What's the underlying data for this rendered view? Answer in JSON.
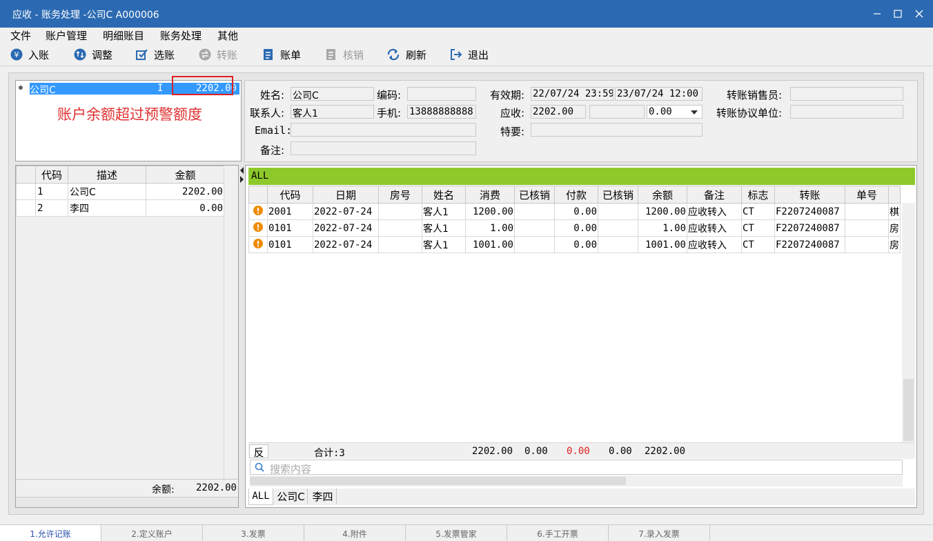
{
  "window": {
    "title": "应收 - 账务处理 -公司C  A000006"
  },
  "menu": [
    "文件",
    "账户管理",
    "明细账目",
    "账务处理",
    "其他"
  ],
  "toolbar": [
    {
      "label": "入账",
      "icon": "yen-icon",
      "enabled": true
    },
    {
      "label": "调整",
      "icon": "adjust-icon",
      "enabled": true
    },
    {
      "label": "选账",
      "icon": "select-check-icon",
      "enabled": true
    },
    {
      "label": "转账",
      "icon": "transfer-icon",
      "enabled": false
    },
    {
      "label": "账单",
      "icon": "bill-icon",
      "enabled": true
    },
    {
      "label": "核销",
      "icon": "writeoff-icon",
      "enabled": false
    },
    {
      "label": "刷新",
      "icon": "refresh-icon",
      "enabled": true
    },
    {
      "label": "退出",
      "icon": "exit-icon",
      "enabled": true
    }
  ],
  "account": {
    "name": "公司C",
    "flag": "I",
    "amount": "2202.00",
    "warning": "账户余额超过预警额度"
  },
  "info": {
    "name_label": "姓名:",
    "name": "公司C",
    "code_label": "编码:",
    "code": "",
    "valid_label": "有效期:",
    "valid_from": "22/07/24 23:59",
    "valid_to": "23/07/24 12:00",
    "sales_label": "转账销售员:",
    "sales": "",
    "contact_label": "联系人:",
    "contact": "客人1",
    "phone_label": "手机:",
    "phone": "13888888888",
    "receivable_label": "应收:",
    "receivable": "2202.00",
    "receivable2": "",
    "receivable_select": "0.00",
    "unit_label": "转账协议单位:",
    "unit": "",
    "email_label": "Email:",
    "email": "",
    "special_label": "特要:",
    "special": "",
    "note_label": "备注:",
    "note": ""
  },
  "left_table": {
    "headers": [
      "代码",
      "描述",
      "金额"
    ],
    "rows": [
      {
        "code": "1",
        "desc": "公司C",
        "amount": "2202.00"
      },
      {
        "code": "2",
        "desc": "李四",
        "amount": "0.00"
      }
    ],
    "balance_label": "余额:",
    "balance": "2202.00"
  },
  "grid": {
    "group": "ALL",
    "headers": [
      "代码",
      "日期",
      "房号",
      "姓名",
      "消费",
      "已核销",
      "付款",
      "已核销",
      "余额",
      "备注",
      "标志",
      "转账",
      "单号"
    ],
    "rows": [
      {
        "code": "2001",
        "date": "2022-07-24",
        "room": "",
        "name": "客人1",
        "consume": "1200.00",
        "wo1": "",
        "pay": "0.00",
        "wo2": "",
        "balance": "1200.00",
        "note": "应收转入",
        "flag": "CT",
        "transfer": "F2207240087",
        "no": "",
        "extra": "棋"
      },
      {
        "code": "0101",
        "date": "2022-07-24",
        "room": "",
        "name": "客人1",
        "consume": "1.00",
        "wo1": "",
        "pay": "0.00",
        "wo2": "",
        "balance": "1.00",
        "note": "应收转入",
        "flag": "CT",
        "transfer": "F2207240087",
        "no": "",
        "extra": "房"
      },
      {
        "code": "0101",
        "date": "2022-07-24",
        "room": "",
        "name": "客人1",
        "consume": "1001.00",
        "wo1": "",
        "pay": "0.00",
        "wo2": "",
        "balance": "1001.00",
        "note": "应收转入",
        "flag": "CT",
        "transfer": "F2207240087",
        "no": "",
        "extra": "房"
      }
    ],
    "reverse_button": "反",
    "total_label": "合计:3",
    "totals": {
      "consume": "2202.00",
      "wo1": "0.00",
      "pay": "0.00",
      "wo2": "0.00",
      "balance": "2202.00"
    },
    "search_placeholder": "搜索内容",
    "tabs": [
      "ALL",
      "公司C",
      "李四"
    ]
  },
  "bottom_tabs": [
    "1.允许记账",
    "2.定义账户",
    "3.发票",
    "4.附件",
    "5.发票管家",
    "6.手工开票",
    "7.录入发票"
  ],
  "colors": {
    "titlebar": "#2b6ab2",
    "selection": "#3399ff",
    "group_bar": "#8ec92b",
    "warning": "#e03030",
    "red_total": "#e02020",
    "active_tab": "#2b4fa8"
  }
}
